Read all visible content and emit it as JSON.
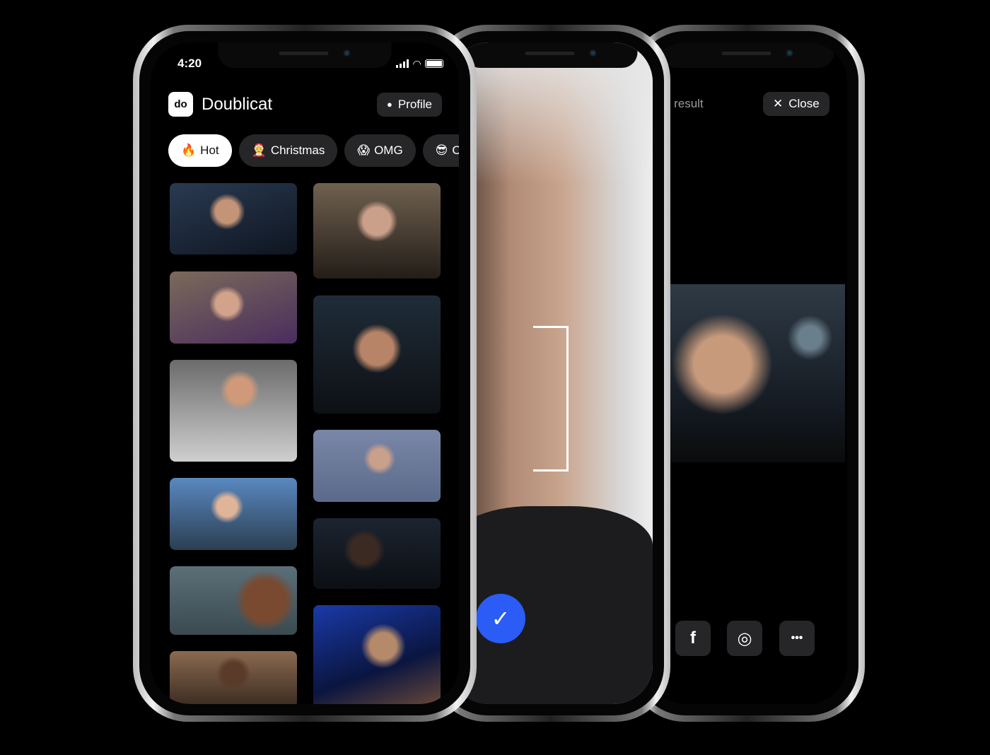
{
  "home": {
    "status_time": "4:20",
    "app_name": "Doublicat",
    "logo_text": "do",
    "profile_label": "Profile",
    "categories": [
      {
        "emoji": "🔥",
        "label": "Hot",
        "active": true
      },
      {
        "emoji": "🤶",
        "label": "Christmas",
        "active": false
      },
      {
        "emoji": "😱",
        "label": "OMG",
        "active": false
      },
      {
        "emoji": "😎",
        "label": "C",
        "active": false
      }
    ]
  },
  "capture": {
    "confirm_icon": "check-icon",
    "accent": "#2b5cf6"
  },
  "result": {
    "title": "Share result",
    "close_label": "Close",
    "share_buttons": [
      {
        "icon": "facebook-icon",
        "glyph": "f"
      },
      {
        "icon": "instagram-icon",
        "glyph": "◎"
      },
      {
        "icon": "more-icon",
        "glyph": "•••"
      }
    ]
  }
}
